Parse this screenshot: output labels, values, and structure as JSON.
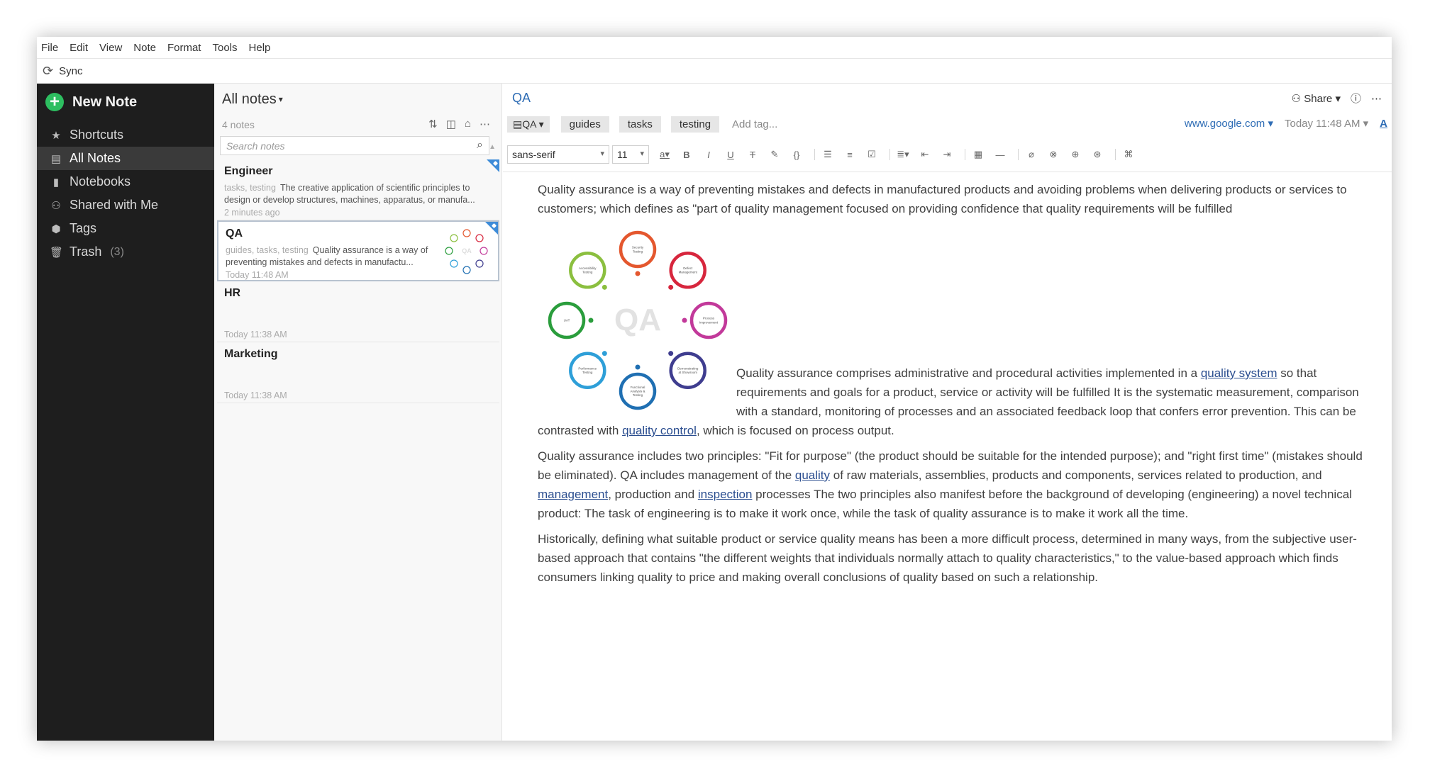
{
  "menu": [
    "File",
    "Edit",
    "View",
    "Note",
    "Format",
    "Tools",
    "Help"
  ],
  "sync_label": "Sync",
  "sidebar": {
    "new_note": "New Note",
    "items": [
      {
        "label": "Shortcuts",
        "icon": "star-icon"
      },
      {
        "label": "All Notes",
        "icon": "note-icon",
        "active": true
      },
      {
        "label": "Notebooks",
        "icon": "notebook-icon"
      },
      {
        "label": "Shared with Me",
        "icon": "people-icon"
      },
      {
        "label": "Tags",
        "icon": "tag-icon"
      },
      {
        "label": "Trash",
        "icon": "trash-icon",
        "count": "(3)"
      }
    ]
  },
  "notelist": {
    "title": "All notes",
    "count": "4 notes",
    "search_placeholder": "Search notes",
    "notes": [
      {
        "title": "Engineer",
        "tags": "tasks, testing",
        "snippet": "The creative application of scientific principles to design or develop structures, machines, apparatus, or manufa...",
        "time": "2 minutes ago",
        "shortcut": true
      },
      {
        "title": "QA",
        "tags": "guides, tasks, testing",
        "snippet": "Quality assurance is a way of preventing mistakes and defects in manufactu...",
        "time": "Today 11:48 AM",
        "shortcut": true,
        "selected": true
      },
      {
        "title": "HR",
        "tags": "",
        "snippet": "",
        "time": "Today 11:38 AM"
      },
      {
        "title": "Marketing",
        "tags": "",
        "snippet": "",
        "time": "Today 11:38 AM"
      }
    ]
  },
  "editor": {
    "title": "QA",
    "share": "Share",
    "notebook": "QA",
    "tags": [
      "guides",
      "tasks",
      "testing"
    ],
    "add_tag": "Add tag...",
    "source_url": "www.google.com",
    "date": "Today 11:48 AM",
    "font": "sans-serif",
    "size": "11",
    "paragraphs": {
      "p1": "Quality assurance is a way of preventing mistakes and defects in manufactured products and avoiding problems when delivering products or services to customers; which  defines as \"part of quality management focused on providing confidence that quality requirements will be fulfilled",
      "p2a": "Quality assurance comprises administrative and procedural activities implemented in a ",
      "p2_link1": "quality system",
      "p2b": " so that requirements and goals for a product, service or activity will be fulfilled It is the systematic measurement, comparison with a standard, monitoring of processes and an associated feedback loop that confers error prevention. This can be contrasted with ",
      "p2_link2": "quality control",
      "p2c": ", which is focused on process output.",
      "p3a": "Quality assurance includes two principles: \"Fit for purpose\" (the product should be suitable for the intended purpose); and \"right first time\" (mistakes should be eliminated). QA includes management of the ",
      "p3_link1": "quality",
      "p3b": " of raw materials, assemblies, products and components, services related to production, and ",
      "p3_link2": "management",
      "p3c": ", production and ",
      "p3_link3": "inspection",
      "p3d": " processes The two principles also manifest before the background of developing (engineering) a novel technical product: The task of engineering is to make it work once, while the task of quality assurance is to make it work all the time.",
      "p4": "Historically, defining what suitable product or service quality means has been a more difficult process, determined in many ways, from the subjective user-based approach that contains \"the different weights that individuals normally attach to quality characteristics,\" to the value-based approach which finds consumers linking quality to price and making overall conclusions of quality based on such a relationship."
    },
    "figure": {
      "center_label": "QA",
      "nodes": [
        {
          "label": "Security Testing",
          "color": "#e4572e"
        },
        {
          "label": "Defect Management",
          "color": "#d7263d"
        },
        {
          "label": "Process Improvement",
          "color": "#c2399a"
        },
        {
          "label": "Demonstrating at Showroom",
          "color": "#3f3d8f"
        },
        {
          "label": "Functional Analysis & Testing",
          "color": "#1f6fb2"
        },
        {
          "label": "Performance Testing",
          "color": "#2e9fd8"
        },
        {
          "label": "UAT",
          "color": "#2a9d3c"
        },
        {
          "label": "Accessibility Testing",
          "color": "#8bbf3f"
        }
      ]
    }
  },
  "colors": {
    "accent": "#2f6db5",
    "sidebar_bg": "#1e1e1e",
    "new_note_green": "#2dbe60",
    "shortcut_blue": "#3d8bd8"
  }
}
